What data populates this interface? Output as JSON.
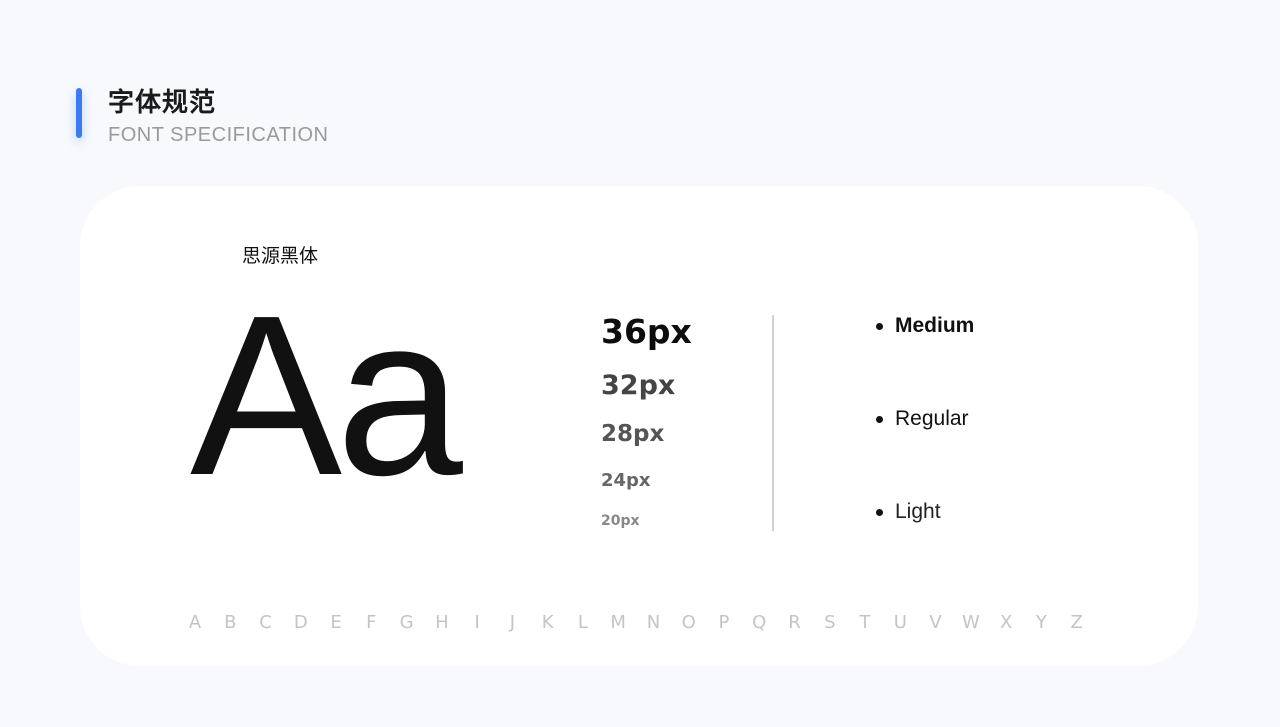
{
  "header": {
    "title": "字体规范",
    "subtitle": "FONT SPECIFICATION",
    "accent_color": "#3b7bf2"
  },
  "card": {
    "font_name": "思源黑体",
    "sample": "Aa",
    "sizes": [
      "36px",
      "32px",
      "28px",
      "24px",
      "20px"
    ],
    "weights": [
      "Medium",
      "Regular",
      "Light"
    ],
    "alphabet": [
      "A",
      "B",
      "C",
      "D",
      "E",
      "F",
      "G",
      "H",
      "I",
      "J",
      "K",
      "L",
      "M",
      "N",
      "O",
      "P",
      "Q",
      "R",
      "S",
      "T",
      "U",
      "V",
      "W",
      "X",
      "Y",
      "Z"
    ]
  }
}
